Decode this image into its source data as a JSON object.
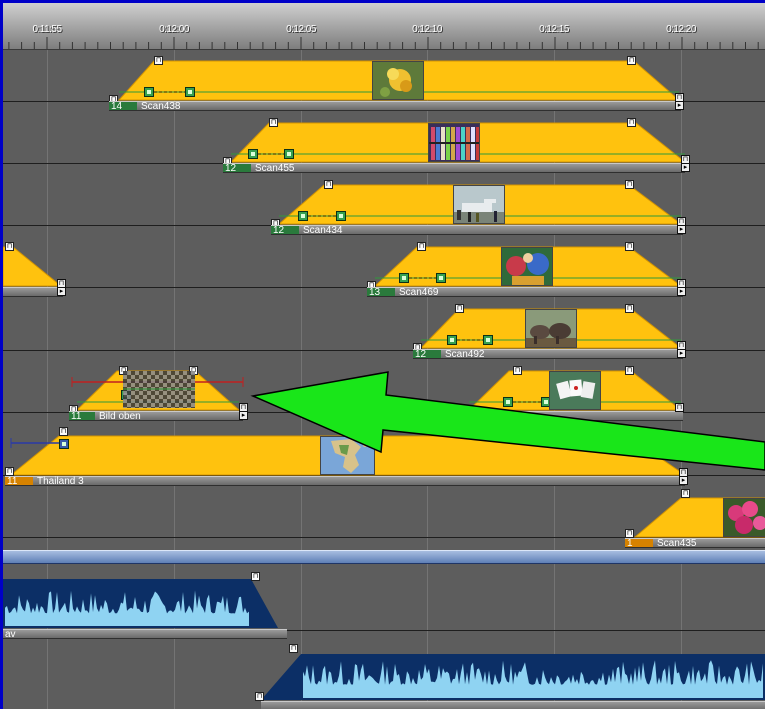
{
  "ruler": {
    "labels": [
      "0:11:55",
      "0:12:00",
      "0:12:05",
      "0:12:10",
      "0:12:15",
      "0:12:20"
    ]
  },
  "clips": [
    {
      "number": "14",
      "name": "Scan438",
      "thumb": "flower"
    },
    {
      "number": "12",
      "name": "Scan455",
      "thumb": "shelf"
    },
    {
      "number": "12",
      "name": "Scan434",
      "thumb": "plane"
    },
    {
      "number": "13",
      "name": "Scan469",
      "thumb": "parade"
    },
    {
      "number": "12",
      "name": "Scan492",
      "thumb": "elephants"
    },
    {
      "number": "",
      "name": "",
      "thumb": "cards"
    },
    {
      "number": "11",
      "name": "Bild oben",
      "thumb": "checker"
    },
    {
      "number": "11",
      "name": "Thailand 3",
      "thumb": "map"
    },
    {
      "number": "1",
      "name": "Scan435",
      "thumb": "orchid"
    }
  ],
  "audio": {
    "track1_label": "av",
    "track2_label": ""
  },
  "colors": {
    "clip_fill": "#ffc20e",
    "accent_arrow": "#19e619",
    "timeline_bg": "#5d5d5d",
    "audio_wave_bg": "#0c2f66",
    "audio_wave": "#8fd3f2",
    "window_border": "#0000c8"
  }
}
